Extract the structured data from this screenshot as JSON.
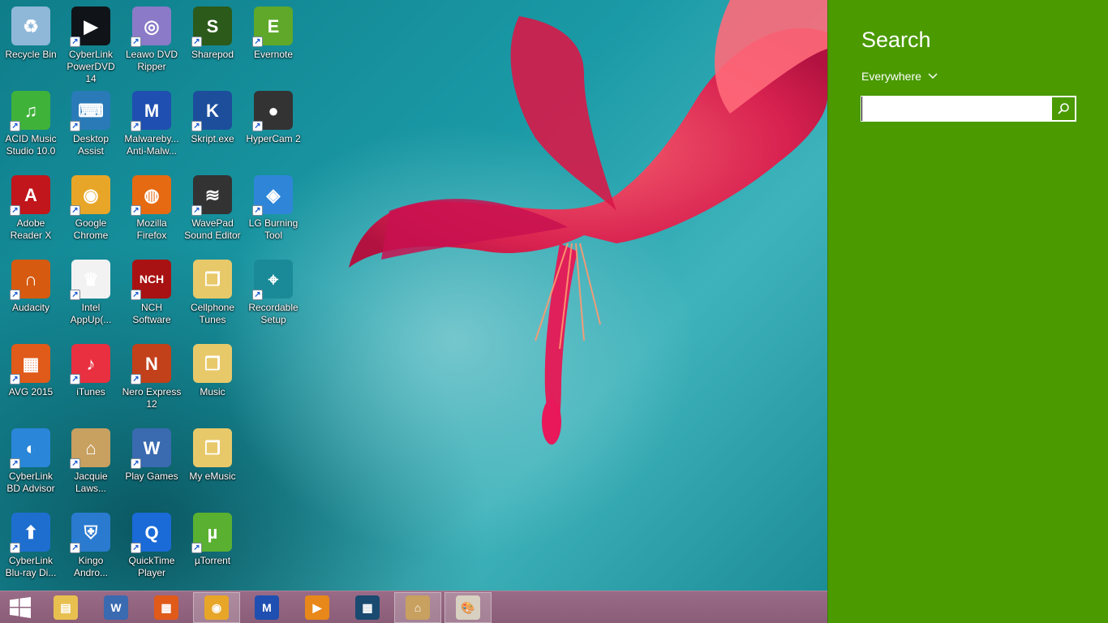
{
  "desktop": {
    "icons": [
      {
        "label": "Recycle Bin",
        "icon": "recycle-bin-icon",
        "color": "#8fb7d8",
        "glyph": "♻",
        "shortcut": false
      },
      {
        "label": "CyberLink PowerDVD 14",
        "icon": "powerdvd-icon",
        "color": "#101418",
        "glyph": "▶",
        "shortcut": true
      },
      {
        "label": "Leawo DVD Ripper",
        "icon": "leawo-dvd-icon",
        "color": "#8a7ac8",
        "glyph": "◎",
        "shortcut": true
      },
      {
        "label": "Sharepod",
        "icon": "sharepod-icon",
        "color": "#2b5a1a",
        "glyph": "S",
        "shortcut": true
      },
      {
        "label": "Evernote",
        "icon": "evernote-icon",
        "color": "#5fa82a",
        "glyph": "E",
        "shortcut": true
      },
      {
        "label": "ACID Music Studio 10.0",
        "icon": "acid-music-icon",
        "color": "#3fb23a",
        "glyph": "♫",
        "shortcut": true
      },
      {
        "label": "Desktop Assist",
        "icon": "desktop-assist-icon",
        "color": "#2a7ab8",
        "glyph": "⌨",
        "shortcut": true
      },
      {
        "label": "Malwareby... Anti-Malw...",
        "icon": "malwarebytes-icon",
        "color": "#1f4fb0",
        "glyph": "M",
        "shortcut": true
      },
      {
        "label": "Skript.exe",
        "icon": "skript-icon",
        "color": "#1c4e9c",
        "glyph": "K",
        "shortcut": true
      },
      {
        "label": "HyperCam 2",
        "icon": "hypercam-icon",
        "color": "#333333",
        "glyph": "●",
        "shortcut": true
      },
      {
        "label": "Adobe Reader X",
        "icon": "adobe-reader-icon",
        "color": "#c0161c",
        "glyph": "A",
        "shortcut": true
      },
      {
        "label": "Google Chrome",
        "icon": "chrome-icon",
        "color": "#e8a628",
        "glyph": "◉",
        "shortcut": true
      },
      {
        "label": "Mozilla Firefox",
        "icon": "firefox-icon",
        "color": "#e66a12",
        "glyph": "◍",
        "shortcut": true
      },
      {
        "label": "WavePad Sound Editor",
        "icon": "wavepad-icon",
        "color": "#333333",
        "glyph": "≋",
        "shortcut": true
      },
      {
        "label": "LG Burning Tool",
        "icon": "lg-burning-icon",
        "color": "#2f86d8",
        "glyph": "◈",
        "shortcut": true
      },
      {
        "label": "Audacity",
        "icon": "audacity-icon",
        "color": "#d65a10",
        "glyph": "∩",
        "shortcut": true
      },
      {
        "label": "Intel AppUp(...",
        "icon": "intel-appup-icon",
        "color": "#f2f2f2",
        "glyph": "♛",
        "shortcut": true
      },
      {
        "label": "NCH Software",
        "icon": "nch-icon",
        "color": "#a81212",
        "glyph": "NCH",
        "shortcut": true
      },
      {
        "label": "Cellphone Tunes",
        "icon": "folder-icon",
        "color": "#e8c96a",
        "glyph": "❒",
        "shortcut": false
      },
      {
        "label": "Recordable Setup",
        "icon": "recordable-icon",
        "color": "#1a8a98",
        "glyph": "⌖",
        "shortcut": true
      },
      {
        "label": "AVG 2015",
        "icon": "avg-icon",
        "color": "#e05a1a",
        "glyph": "▦",
        "shortcut": true
      },
      {
        "label": "iTunes",
        "icon": "itunes-icon",
        "color": "#e83040",
        "glyph": "♪",
        "shortcut": true
      },
      {
        "label": "Nero Express 12",
        "icon": "nero-icon",
        "color": "#c2401a",
        "glyph": "N",
        "shortcut": true
      },
      {
        "label": "Music",
        "icon": "folder-icon",
        "color": "#e8c96a",
        "glyph": "❒",
        "shortcut": false
      },
      {
        "label": "CyberLink BD Advisor",
        "icon": "bd-advisor-icon",
        "color": "#2a86d8",
        "glyph": "◐",
        "shortcut": true
      },
      {
        "label": "Jacquie Laws...",
        "icon": "jacquie-lawson-icon",
        "color": "#c8a060",
        "glyph": "⌂",
        "shortcut": true
      },
      {
        "label": "Play Games",
        "icon": "play-games-icon",
        "color": "#3a6ab0",
        "glyph": "W",
        "shortcut": true
      },
      {
        "label": "My eMusic",
        "icon": "folder-icon",
        "color": "#e8c96a",
        "glyph": "❒",
        "shortcut": false
      },
      {
        "label": "CyberLink Blu-ray Di...",
        "icon": "bluray-icon",
        "color": "#1e6ed0",
        "glyph": "⬆",
        "shortcut": true
      },
      {
        "label": "Kingo Andro...",
        "icon": "kingo-icon",
        "color": "#2a7ad0",
        "glyph": "⛨",
        "shortcut": true
      },
      {
        "label": "QuickTime Player",
        "icon": "quicktime-icon",
        "color": "#1a6ad8",
        "glyph": "Q",
        "shortcut": true
      },
      {
        "label": "µTorrent",
        "icon": "utorrent-icon",
        "color": "#5ab030",
        "glyph": "µ",
        "shortcut": true
      }
    ]
  },
  "taskbar": {
    "buttons": [
      {
        "name": "start-button",
        "icon": "windows-logo-icon",
        "color": "#ffffff",
        "glyph": "",
        "active": false
      },
      {
        "name": "file-explorer-button",
        "icon": "file-explorer-icon",
        "color": "#e8c050",
        "glyph": "▤",
        "active": false
      },
      {
        "name": "play-games-taskbar-button",
        "icon": "play-games-icon",
        "color": "#3a6ab0",
        "glyph": "W",
        "active": false
      },
      {
        "name": "avg-taskbar-button",
        "icon": "avg-icon",
        "color": "#e05a1a",
        "glyph": "▦",
        "active": false
      },
      {
        "name": "chrome-taskbar-button",
        "icon": "chrome-icon",
        "color": "#e8a628",
        "glyph": "◉",
        "active": true
      },
      {
        "name": "malwarebytes-taskbar-button",
        "icon": "malwarebytes-icon",
        "color": "#1f4fb0",
        "glyph": "M",
        "active": false
      },
      {
        "name": "media-player-taskbar-button",
        "icon": "media-player-icon",
        "color": "#e8881a",
        "glyph": "▶",
        "active": false
      },
      {
        "name": "film-taskbar-button",
        "icon": "film-reel-icon",
        "color": "#1a4a70",
        "glyph": "▦",
        "active": false
      },
      {
        "name": "jacquie-lawson-taskbar-button",
        "icon": "jacquie-lawson-icon",
        "color": "#c8a060",
        "glyph": "⌂",
        "active": true
      },
      {
        "name": "paint-taskbar-button",
        "icon": "paint-palette-icon",
        "color": "#d8d0c0",
        "glyph": "🎨",
        "active": true
      }
    ]
  },
  "search": {
    "title": "Search",
    "scope": "Everywhere",
    "input_value": "",
    "placeholder": ""
  },
  "colors": {
    "charm_green": "#4a9a00",
    "taskbar": "#8f6280"
  }
}
